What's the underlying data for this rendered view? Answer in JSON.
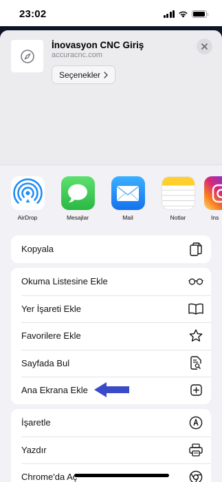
{
  "status_bar": {
    "time": "23:02",
    "battery_level": 0.95
  },
  "site": {
    "title": "İnovasyon CNC Giriş",
    "url": "accuracnc.com",
    "options_label": "Seçenekler",
    "icon": "compass-icon"
  },
  "apps": [
    {
      "label": "AirDrop",
      "icon": "airdrop-icon",
      "color": "#1e8cf5"
    },
    {
      "label": "Mesajlar",
      "icon": "messages-icon",
      "color": "#34c759"
    },
    {
      "label": "Mail",
      "icon": "mail-icon",
      "color": "#1a8cff"
    },
    {
      "label": "Notlar",
      "icon": "notes-icon",
      "color": "#ffd60a"
    },
    {
      "label": "Ins",
      "icon": "instagram-icon",
      "color": "#d6249f"
    }
  ],
  "actions": {
    "group1": [
      {
        "label": "Kopyala",
        "icon": "copy-icon"
      }
    ],
    "group2": [
      {
        "label": "Okuma Listesine Ekle",
        "icon": "glasses-icon"
      },
      {
        "label": "Yer İşareti Ekle",
        "icon": "book-icon"
      },
      {
        "label": "Favorilere Ekle",
        "icon": "star-icon"
      },
      {
        "label": "Sayfada Bul",
        "icon": "find-in-page-icon"
      },
      {
        "label": "Ana Ekrana Ekle",
        "icon": "add-square-icon"
      }
    ],
    "group3": [
      {
        "label": "İşaretle",
        "icon": "markup-icon"
      },
      {
        "label": "Yazdır",
        "icon": "printer-icon"
      },
      {
        "label": "Chrome'da Aç",
        "icon": "chrome-icon"
      }
    ]
  },
  "annotation_arrow_color": "#3b4bc8"
}
